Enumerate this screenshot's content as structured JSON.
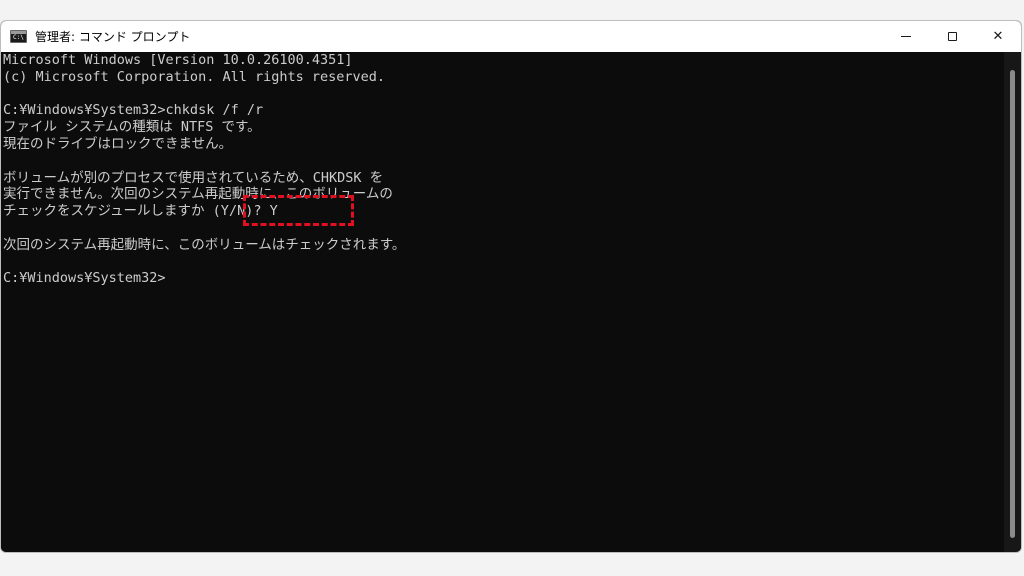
{
  "window": {
    "title": "管理者: コマンド プロンプト",
    "app_icon_glyph": "C:\\",
    "buttons": {
      "minimize": "minimize-icon",
      "maximize": "maximize-icon",
      "close_glyph": "✕"
    }
  },
  "console": {
    "lines": [
      "Microsoft Windows [Version 10.0.26100.4351]",
      "(c) Microsoft Corporation. All rights reserved.",
      "",
      "C:¥Windows¥System32>chkdsk /f /r",
      "ファイル システムの種類は NTFS です。",
      "現在のドライブはロックできません。",
      "",
      "ボリュームが別のプロセスで使用されているため、CHKDSK を",
      "実行できません。次回のシステム再起動時に、このボリュームの",
      "チェックをスケジュールしますか (Y/N)? Y",
      "",
      "次回のシステム再起動時に、このボリュームはチェックされます。",
      "",
      "C:¥Windows¥System32>"
    ]
  },
  "colors": {
    "console_bg": "#0c0c0c",
    "console_text": "#cccccc",
    "highlight": "#e01020"
  }
}
